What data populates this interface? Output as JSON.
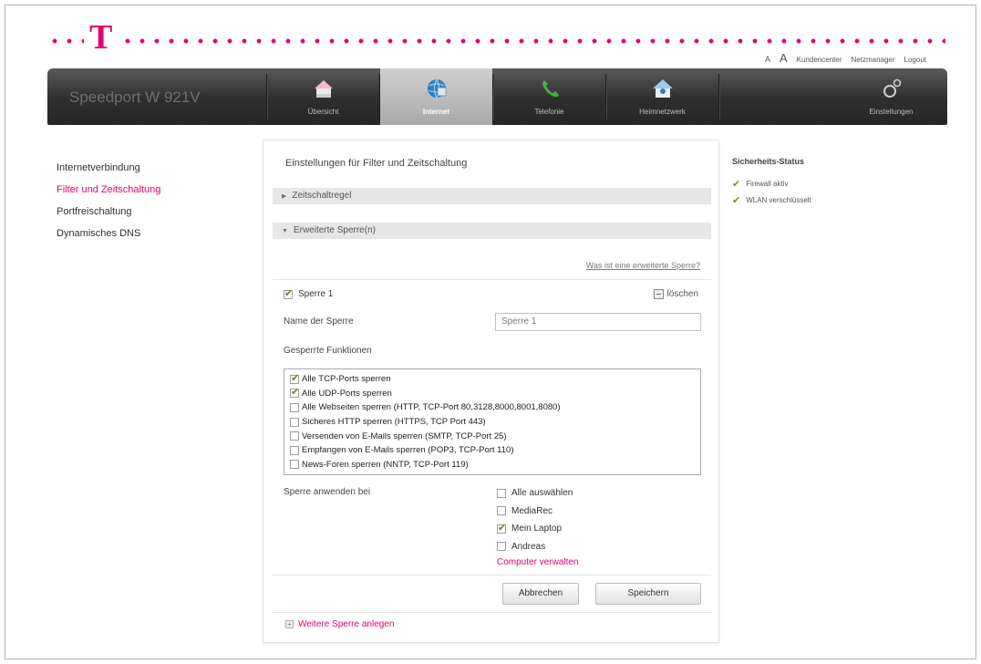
{
  "header": {
    "logo_letter": "T",
    "font_small": "A",
    "font_large": "A",
    "links": [
      "Kundencenter",
      "Netzmanager",
      "Logout"
    ]
  },
  "navbar": {
    "router_name": "Speedport W 921V",
    "items": [
      {
        "label": "Übersicht",
        "icon": "home-icon",
        "active": false
      },
      {
        "label": "Internet",
        "icon": "globe-icon",
        "active": true
      },
      {
        "label": "Telefonie",
        "icon": "phone-icon",
        "active": false
      },
      {
        "label": "Heimnetzwerk",
        "icon": "home-network-icon",
        "active": false
      },
      {
        "label": "Einstellungen",
        "icon": "gears-icon",
        "active": false
      }
    ]
  },
  "sidebar": {
    "items": [
      {
        "label": "Internetverbindung",
        "selected": false
      },
      {
        "label": "Filter und Zeitschaltung",
        "selected": true
      },
      {
        "label": "Portfreischaltung",
        "selected": false
      },
      {
        "label": "Dynamisches DNS",
        "selected": false
      }
    ]
  },
  "main": {
    "title": "Einstellungen für Filter und Zeitschaltung",
    "accordion_timer": "Zeitschaltregel",
    "accordion_blocks": "Erweiterte Sperre(n)",
    "help_link": "Was ist eine erweiterte Sperre?",
    "rule": {
      "label": "Sperre 1",
      "checked": true,
      "delete_label": "löschen",
      "name_label": "Name der Sperre",
      "name_value": "Sperre 1",
      "functions_label": "Gesperrte Funktionen",
      "functions": [
        {
          "label": "Alle TCP-Ports sperren",
          "checked": true
        },
        {
          "label": "Alle UDP-Ports sperren",
          "checked": true
        },
        {
          "label": "Alle Webseiten sperren (HTTP, TCP-Port 80,3128,8000,8001,8080)",
          "checked": false
        },
        {
          "label": "Sicheres HTTP sperren (HTTPS, TCP Port 443)",
          "checked": false
        },
        {
          "label": "Versenden von E-Mails sperren (SMTP, TCP-Port 25)",
          "checked": false
        },
        {
          "label": "Empfangen von E-Mails sperren (POP3, TCP-Port 110)",
          "checked": false
        },
        {
          "label": "News-Foren sperren (NNTP, TCP-Port 119)",
          "checked": false
        }
      ],
      "apply_label": "Sperre anwenden bei",
      "devices": [
        {
          "label": "Alle auswählen",
          "checked": false
        },
        {
          "label": "MediaRec",
          "checked": false
        },
        {
          "label": "Mein Laptop",
          "checked": true
        },
        {
          "label": "Andreas",
          "checked": false
        }
      ],
      "manage_link": "Computer verwalten"
    },
    "cancel_label": "Abbrechen",
    "save_label": "Speichern",
    "add_rule_label": "Weitere Sperre anlegen"
  },
  "status": {
    "title": "Sicherheits-Status",
    "items": [
      "Firewall aktiv",
      "WLAN verschlüsselt"
    ]
  },
  "colors": {
    "brand": "#e20074",
    "ok": "#6a9a2a"
  }
}
